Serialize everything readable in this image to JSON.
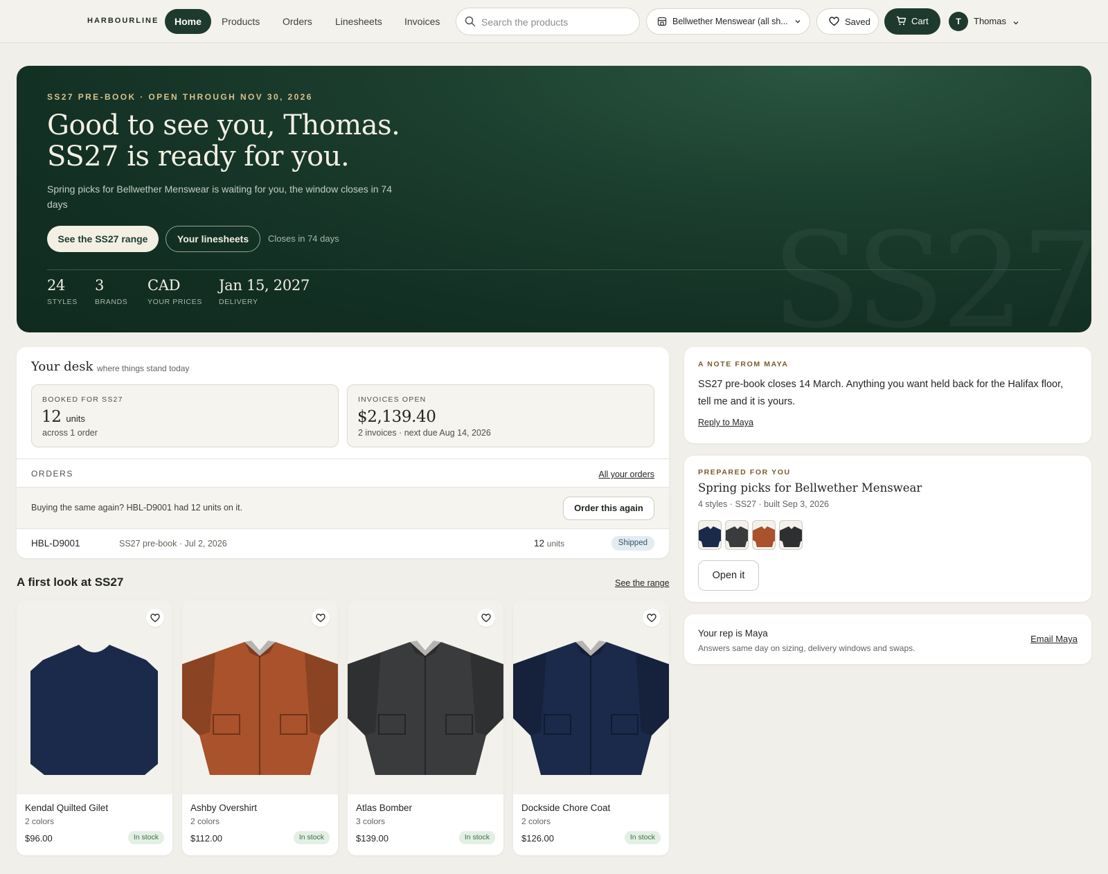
{
  "nav": {
    "brand": "HARBOURLINE",
    "links": [
      "Home",
      "Products",
      "Orders",
      "Linesheets",
      "Invoices"
    ],
    "search_placeholder": "Search the products",
    "store": "Bellwether Menswear (all sh...",
    "saved": "Saved",
    "cart": "Cart",
    "user_initial": "T",
    "user_name": "Thomas"
  },
  "hero": {
    "eyebrow": "SS27 PRE-BOOK · OPEN THROUGH NOV 30, 2026",
    "headline_1": "Good to see you, Thomas.",
    "headline_2": "SS27 is ready for you.",
    "subtitle": "Spring picks for Bellwether Menswear is waiting for you, the window closes in 74 days",
    "cta_primary": "See the SS27 range",
    "cta_secondary": "Your linesheets",
    "closes": "Closes in 74 days",
    "stats": [
      {
        "value": "24",
        "label": "STYLES"
      },
      {
        "value": "3",
        "label": "BRANDS"
      },
      {
        "value": "CAD",
        "label": "YOUR PRICES"
      },
      {
        "value": "Jan 15, 2027",
        "label": "DELIVERY"
      }
    ],
    "watermark": "SS27"
  },
  "desk": {
    "title": "Your desk",
    "subtitle": "where things stand today",
    "booked": {
      "label": "BOOKED FOR SS27",
      "value": "12",
      "unit": "units",
      "note": "across 1 order"
    },
    "invoices": {
      "label": "INVOICES OPEN",
      "value": "$2,139.40",
      "note": "2 invoices · next due Aug 14, 2026"
    },
    "orders_label": "ORDERS",
    "all_orders": "All your orders",
    "reorder_text": "Buying the same again? HBL-D9001 had 12 units on it.",
    "reorder_button": "Order this again",
    "order": {
      "id": "HBL-D9001",
      "meta": "SS27 pre-book · Jul 2, 2026",
      "units": "12",
      "units_label": "units",
      "status": "Shipped"
    }
  },
  "first_look": {
    "title": "A first look at SS27",
    "link": "See the range",
    "products": [
      {
        "name": "Kendal Quilted Gilet",
        "colors": "2 colors",
        "price": "$96.00",
        "stock": "In stock",
        "color": "#1b2a4a",
        "icon": "sweater-icon"
      },
      {
        "name": "Ashby Overshirt",
        "colors": "2 colors",
        "price": "$112.00",
        "stock": "In stock",
        "color": "#a9522b",
        "icon": "jacket-icon"
      },
      {
        "name": "Atlas Bomber",
        "colors": "3 colors",
        "price": "$139.00",
        "stock": "In stock",
        "color": "#3a3b3c",
        "icon": "jacket-icon"
      },
      {
        "name": "Dockside Chore Coat",
        "colors": "2 colors",
        "price": "$126.00",
        "stock": "In stock",
        "color": "#1b2a4a",
        "icon": "jacket-icon"
      }
    ]
  },
  "note": {
    "eyebrow": "A NOTE FROM MAYA",
    "body": "SS27 pre-book closes 14 March. Anything you want held back for the Halifax floor, tell me and it is yours.",
    "link": "Reply to Maya"
  },
  "prepared": {
    "eyebrow": "PREPARED FOR YOU",
    "title": "Spring picks for Bellwether Menswear",
    "meta": "4 styles · SS27 · built Sep 3, 2026",
    "swatch_colors": [
      "#1b2a4a",
      "#3a3b3c",
      "#a9522b",
      "#2e2f30"
    ],
    "button": "Open it"
  },
  "rep": {
    "title": "Your rep is Maya",
    "subtitle": "Answers same day on sizing, delivery windows and swaps.",
    "link": "Email Maya"
  },
  "colors": {
    "brand_green": "#1e3a2e",
    "accent_gold": "#d9c18b",
    "background": "#f1efe9"
  }
}
